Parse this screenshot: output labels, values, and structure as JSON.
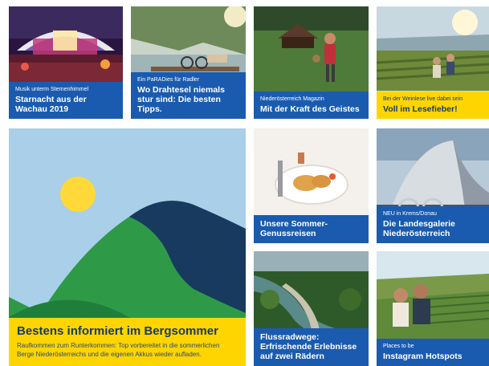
{
  "cards": [
    {
      "kicker": "Musik unterm Sternenhimmel",
      "title": "Starnacht aus der Wachau 2019"
    },
    {
      "kicker": "Ein PaRADies für Radler",
      "title": "Wo Drahtesel niemals stur sind: Die besten Tipps."
    },
    {
      "kicker": "Niederösterreich Magazin",
      "title": "Mit der Kraft des Geistes"
    },
    {
      "kicker": "Bei der Weinlese live dabei sein",
      "title": "Voll im Lesefieber!"
    },
    {
      "kicker": "",
      "title": "Unsere Sommer-Genussreisen"
    },
    {
      "kicker": "NEU in Krems/Donau",
      "title": "Die Landesgalerie Niederösterreich"
    },
    {
      "kicker": "",
      "title": "Flussradwege: Erfrischende Erlebnisse auf zwei Rädern"
    },
    {
      "kicker": "Places to be",
      "title": "Instagram Hotspots"
    }
  ],
  "hero": {
    "title": "Bestens informiert im Bergsommer",
    "description": "Raufkommen zum Runterkommen: Top vorbereitet in die sommerlichen Berge Niederösterreichs und die eigenen Akkus wieder aufladen."
  },
  "colors": {
    "brand_blue": "#1a5bb0",
    "brand_yellow": "#ffd500",
    "text_navy": "#163a6b"
  }
}
